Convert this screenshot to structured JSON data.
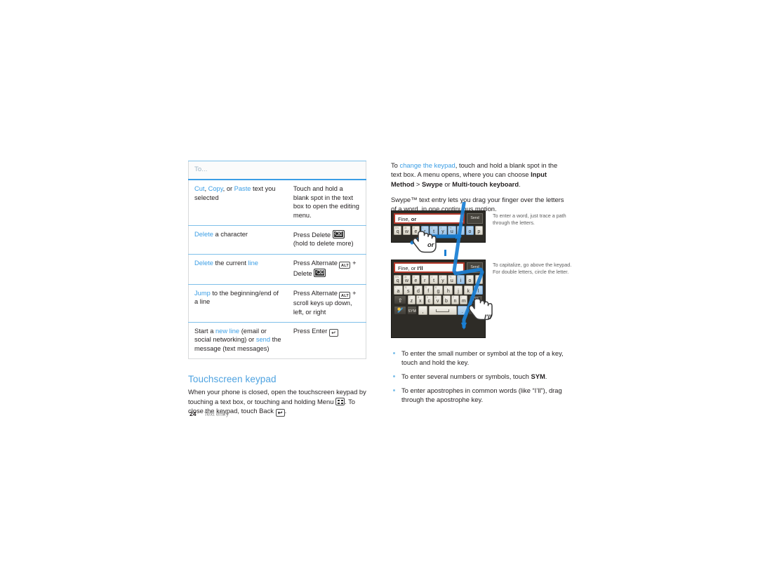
{
  "document": {
    "page_number": "24",
    "footer_label": "Text entry"
  },
  "table": {
    "header": "To...",
    "rows": [
      {
        "action_parts": [
          {
            "text": "Cut",
            "style": "blue"
          },
          {
            "text": ", ",
            "style": "plain"
          },
          {
            "text": "Copy",
            "style": "blue"
          },
          {
            "text": ", or ",
            "style": "plain"
          },
          {
            "text": "Paste",
            "style": "blue"
          },
          {
            "text": " text you selected",
            "style": "plain"
          }
        ],
        "how": "Touch and hold a blank spot in the text box to open the editing menu."
      },
      {
        "action_parts": [
          {
            "text": "Delete",
            "style": "blue"
          },
          {
            "text": " a character",
            "style": "plain"
          }
        ],
        "how": "Press Delete",
        "how_suffix": "(hold to delete more)",
        "keys": [
          "delete"
        ]
      },
      {
        "action_parts": [
          {
            "text": "Delete",
            "style": "blue"
          },
          {
            "text": " the current ",
            "style": "plain"
          },
          {
            "text": "line",
            "style": "blue"
          }
        ],
        "how": "Press Alternate",
        "how_mid": "+ Delete",
        "keys": [
          "alt",
          "delete"
        ]
      },
      {
        "action_parts": [
          {
            "text": "Jump",
            "style": "blue"
          },
          {
            "text": " to the beginning/end of a line",
            "style": "plain"
          }
        ],
        "how": "Press Alternate",
        "how_mid": "+ scroll keys up down, left, or right",
        "keys": [
          "alt"
        ]
      },
      {
        "action_parts": [
          {
            "text": "Start a ",
            "style": "plain"
          },
          {
            "text": "new line",
            "style": "blue"
          },
          {
            "text": " (email or social networking) or ",
            "style": "plain"
          },
          {
            "text": "send",
            "style": "blue"
          },
          {
            "text": " the message (text messages)",
            "style": "plain"
          }
        ],
        "how": "Press Enter",
        "keys": [
          "enter"
        ]
      }
    ]
  },
  "touchscreen_section": {
    "heading": "Touchscreen keypad",
    "body_1": "When your phone is closed, open the touchscreen keypad by touching a text box, or touching and holding Menu",
    "body_2": ". To close the keypad, touch Back",
    "body_3": "."
  },
  "right_column": {
    "para1_parts": [
      {
        "text": "To ",
        "style": "plain"
      },
      {
        "text": "change the keypad",
        "style": "blue"
      },
      {
        "text": ", touch and hold a blank spot in the text box. A menu opens, where you can choose ",
        "style": "plain"
      },
      {
        "text": "Input Method",
        "style": "bold"
      },
      {
        "text": " > ",
        "style": "plain"
      },
      {
        "text": "Swype",
        "style": "bold"
      },
      {
        "text": " or ",
        "style": "plain"
      },
      {
        "text": "Multi-touch keyboard",
        "style": "bold"
      },
      {
        "text": ".",
        "style": "plain"
      }
    ],
    "para2": "Swype™ text entry lets you drag your finger over the letters of a word, in one continuous motion."
  },
  "figure_1": {
    "text_field_value_plain": "Fine, ",
    "text_field_value_bold": "or",
    "send_label": "Send",
    "gesture_label": "or",
    "keys_row1": [
      "q",
      "w",
      "e",
      "r",
      "t",
      "y",
      "u",
      "i",
      "o",
      "p"
    ],
    "sups_row1": [
      "EN",
      "@",
      "#",
      "1",
      "2",
      "3",
      "%",
      "+",
      "(",
      ")"
    ],
    "lit_row1": [
      3,
      4,
      5,
      6,
      7,
      8
    ],
    "callout": "To enter a word, just trace a path through the letters."
  },
  "figure_2": {
    "text_field_value_plain": "Fine, or ",
    "text_field_value_bold": "I'll",
    "send_label": "Send",
    "gesture_label": "I'll",
    "keys_row1": [
      "q",
      "w",
      "e",
      "r",
      "t",
      "y",
      "u",
      "i",
      "o",
      "p"
    ],
    "sups_row1": [
      "EN",
      "@",
      "#",
      "1",
      "2",
      "3",
      "%",
      "+",
      "(",
      ")"
    ],
    "keys_row2": [
      "a",
      "s",
      "d",
      "f",
      "g",
      "h",
      "j",
      "k",
      "l"
    ],
    "sups_row2": [
      "*",
      "$",
      "4",
      "5",
      "6",
      "+",
      "-",
      ":",
      "'"
    ],
    "keys_row3": [
      "z",
      "x",
      "c",
      "v",
      "b",
      "n",
      "m"
    ],
    "sups_row3": [
      "7",
      "8",
      "9",
      "0",
      "/",
      "?",
      "!"
    ],
    "sym_label": "SYM",
    "comma_label": ",",
    "period_label": ".",
    "smiley_label": ":-)",
    "callout": "To capitalize, go above the keypad. For double letters, circle the letter."
  },
  "bullets": [
    {
      "parts": [
        {
          "text": "To enter the small number or symbol at the top of a key, touch and hold the key.",
          "style": "plain"
        }
      ]
    },
    {
      "parts": [
        {
          "text": "To enter several numbers or symbols, touch ",
          "style": "plain"
        },
        {
          "text": "SYM",
          "style": "bold"
        },
        {
          "text": ".",
          "style": "plain"
        }
      ]
    },
    {
      "parts": [
        {
          "text": "To enter apostrophes in common words (like “I’ll”), drag through the apostrophe key.",
          "style": "plain"
        }
      ]
    }
  ],
  "colors": {
    "accent_blue": "#3b9ee5",
    "heading_blue": "#4da2e0",
    "rule_blue": "#7fc0ea",
    "field_border_red": "#b4392b",
    "trace_blue": "#1a7fd4"
  }
}
